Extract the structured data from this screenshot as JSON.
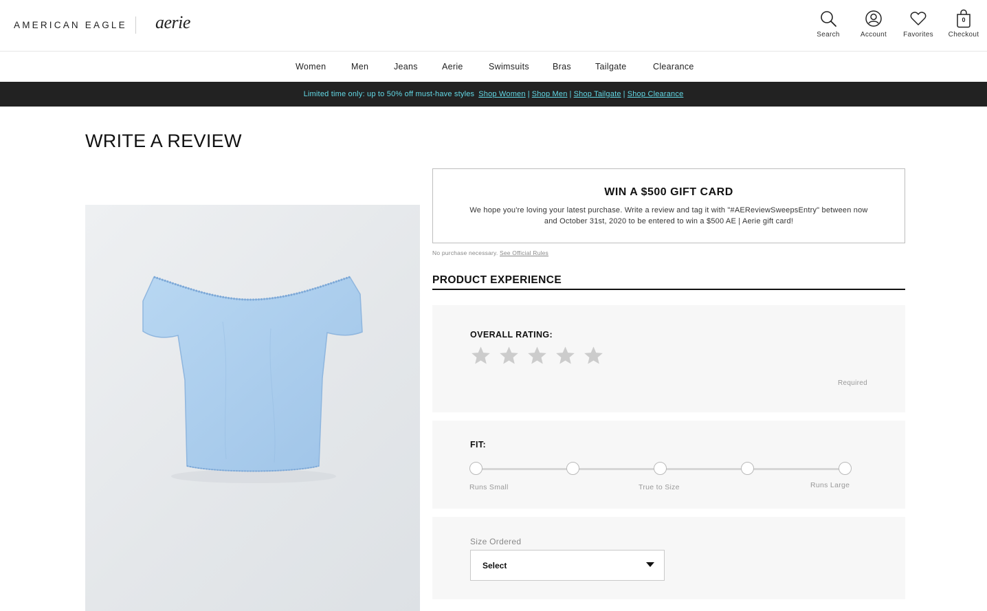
{
  "header": {
    "brand_ae": "AMERICAN EAGLE",
    "brand_aerie": "aerie",
    "utilities": [
      {
        "label": "Search",
        "icon": "search-icon"
      },
      {
        "label": "Account",
        "icon": "account-icon"
      },
      {
        "label": "Favorites",
        "icon": "heart-icon"
      },
      {
        "label": "Checkout",
        "icon": "bag-icon",
        "count": "0"
      }
    ]
  },
  "nav": {
    "items": [
      "Women",
      "Men",
      "Jeans",
      "Aerie",
      "Swimsuits",
      "Bras",
      "Tailgate",
      "Clearance"
    ]
  },
  "promo_banner": {
    "text": "Limited time only: up to 50% off must-have styles",
    "links": [
      "Shop Women",
      "Shop Men",
      "Shop Tailgate",
      "Shop Clearance"
    ],
    "separator": "|",
    "text_color": "#62d9e6",
    "background": "#222222"
  },
  "page": {
    "title": "WRITE A REVIEW"
  },
  "product": {
    "image_icon": "off-shoulder-top-image",
    "color": "#aed0ee"
  },
  "giveaway": {
    "title": "WIN A $500 GIFT CARD",
    "body": "We hope you're loving your latest purchase. Write a review and tag it with \"#AEReviewSweepsEntry\" between now and October 31st, 2020 to be entered to win a $500 AE | Aerie gift card!",
    "legal_text": "No purchase necessary.",
    "legal_link": "See Official Rules"
  },
  "experience": {
    "section_title": "PRODUCT EXPERIENCE",
    "rating": {
      "label": "OVERALL RATING:",
      "stars": 5,
      "selected": 0,
      "required_text": "Required"
    },
    "fit": {
      "label": "FIT:",
      "options": 5,
      "caption_left": "Runs Small",
      "caption_mid": "True to Size",
      "caption_right": "Runs Large"
    },
    "size": {
      "label": "Size Ordered",
      "selected": "Select"
    }
  }
}
